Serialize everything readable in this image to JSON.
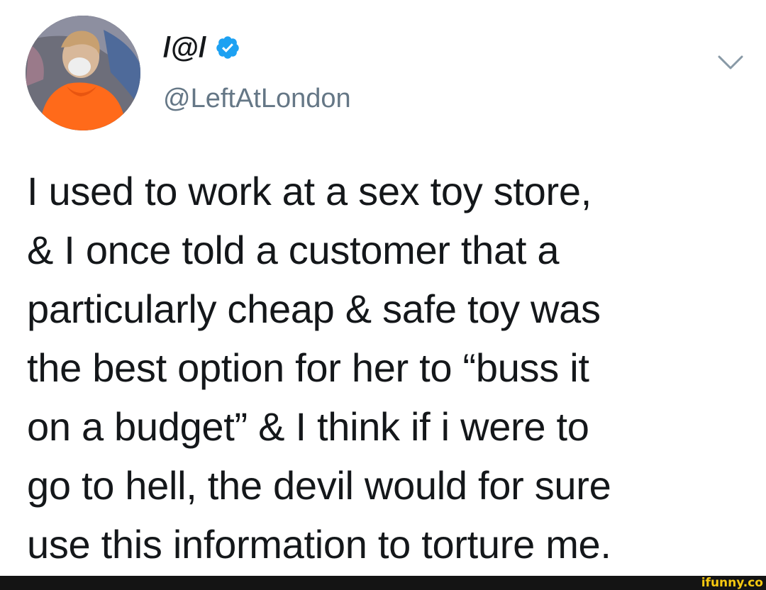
{
  "tweet": {
    "display_name": "/@/",
    "handle": "@LeftAtLondon",
    "verified": true,
    "verified_icon": "verified-badge-icon",
    "menu_icon": "chevron-down-icon",
    "text": "I used to work at a sex toy store,\n& I once told a customer that a\nparticularly cheap & safe toy was\nthe best option for her to “buss it\non a budget” & I think if i were to\ngo to hell, the devil would for sure\nuse this information to torture me."
  },
  "watermark": {
    "text": "ifunny.co"
  },
  "colors": {
    "text_primary": "#14171a",
    "text_secondary": "#657786",
    "verified_blue": "#1da1f2",
    "chevron_gray": "#8899a6",
    "footer_bg": "#141414",
    "watermark_yellow": "#f7c910"
  }
}
